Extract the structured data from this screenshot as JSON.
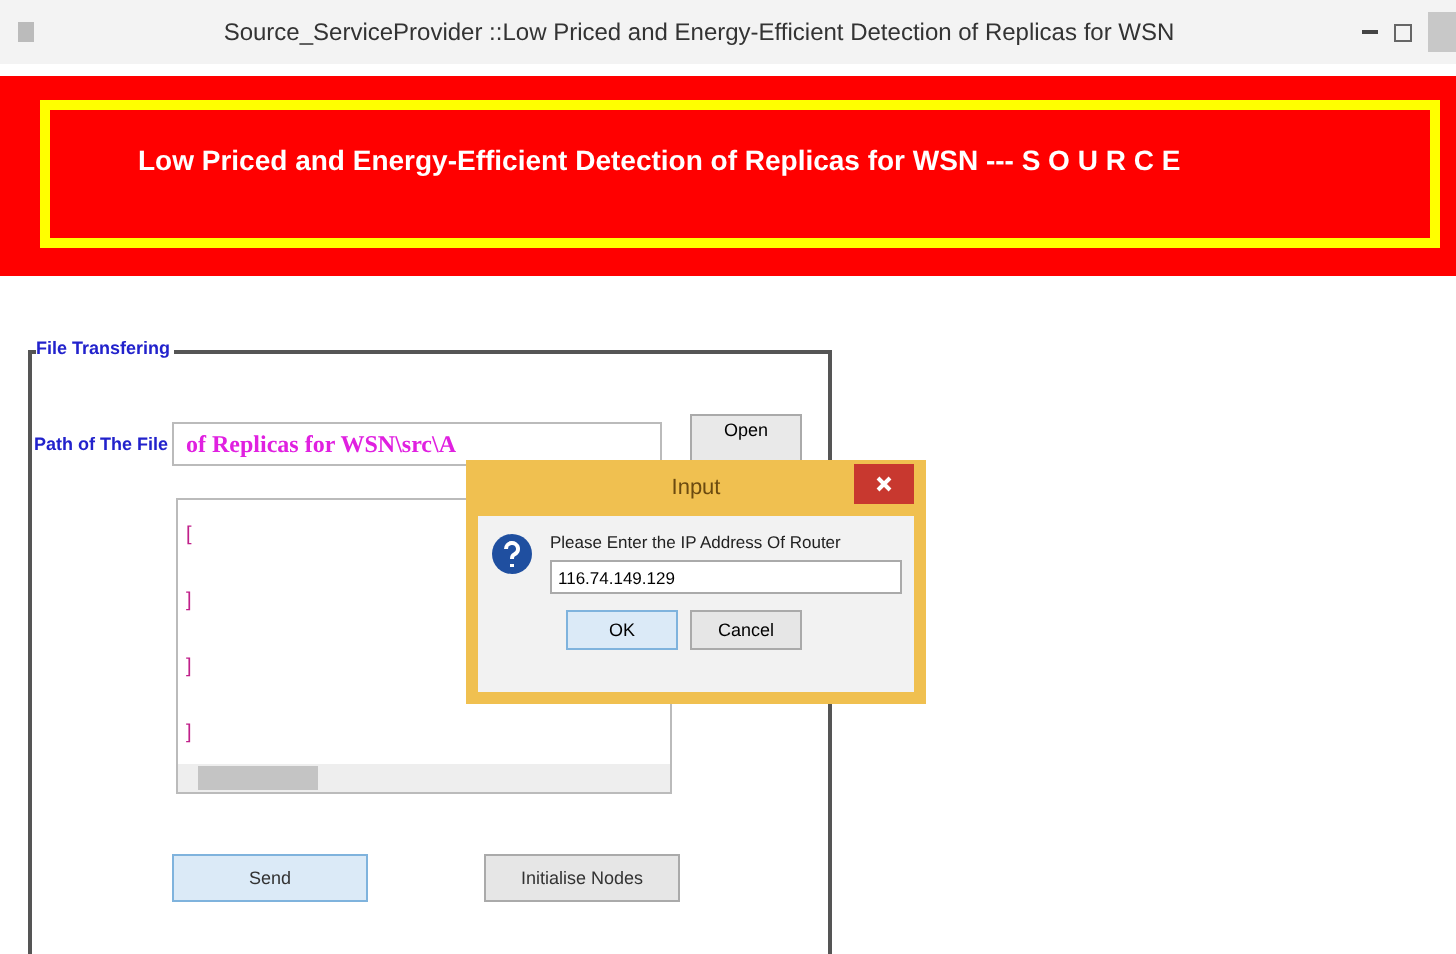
{
  "window": {
    "title": "Source_ServiceProvider ::Low Priced and Energy-Efficient Detection of Replicas for WSN"
  },
  "banner": {
    "text": "Low Priced and Energy-Efficient Detection of Replicas for WSN --- S O U R C E"
  },
  "file_panel": {
    "legend": "File Transfering",
    "path_label": "Path of The File",
    "path_value": "of Replicas for WSN\\src\\A",
    "open_button": "Open",
    "text_lines": [
      "[",
      "]",
      "]",
      "]"
    ],
    "buttons": [
      {
        "label": "Send",
        "selected": true
      },
      {
        "label": "Initialise Nodes",
        "selected": false
      }
    ]
  },
  "dialog": {
    "title": "Input",
    "message": "Please Enter the IP Address Of Router",
    "value": "116.74.149.129",
    "buttons": [
      {
        "label": "OK",
        "selected": true
      },
      {
        "label": "Cancel",
        "selected": false
      }
    ]
  }
}
